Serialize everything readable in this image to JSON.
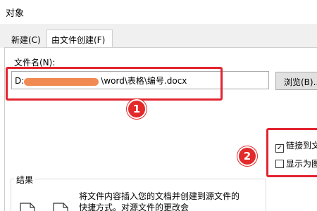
{
  "window": {
    "title": "对象"
  },
  "tabs": [
    {
      "label": "新建(C)",
      "active": false
    },
    {
      "label": "由文件创建(F)",
      "active": true
    }
  ],
  "file": {
    "label": "文件名(N):",
    "value_prefix": "D:",
    "value_suffix": "\\word\\表格\\编号.docx"
  },
  "browse_button": "浏览(B)...",
  "options": [
    {
      "label": "链接到文",
      "checked": true,
      "mark": "✓"
    },
    {
      "label": "显示为图",
      "checked": false,
      "mark": ""
    }
  ],
  "result": {
    "label": "结果",
    "text": "将文件内容插入您的文档并创建到源文件的快捷方式。对源文件的更改会"
  },
  "annotations": {
    "badge1": "1",
    "badge2": "2"
  },
  "colors": {
    "highlight": "#e2242f",
    "redaction": "#f08a52",
    "badge": "#e32a2a"
  }
}
